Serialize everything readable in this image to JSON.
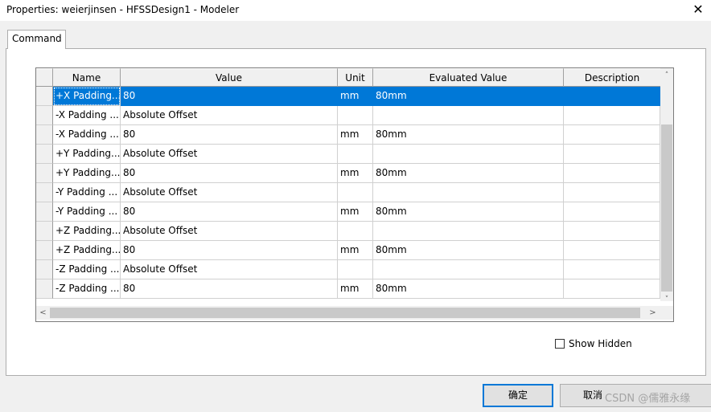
{
  "window": {
    "title": "Properties: weierjinsen - HFSSDesign1 - Modeler",
    "close_glyph": "✕"
  },
  "tab": {
    "label": "Command"
  },
  "table": {
    "columns": [
      "Name",
      "Value",
      "Unit",
      "Evaluated Value",
      "Description"
    ],
    "rows": [
      {
        "name": "+X Padding...",
        "value": "80",
        "unit": "mm",
        "evaluated": "80mm",
        "description": ""
      },
      {
        "name": "-X Padding ...",
        "value": "Absolute Offset",
        "unit": "",
        "evaluated": "",
        "description": ""
      },
      {
        "name": "-X Padding ...",
        "value": "80",
        "unit": "mm",
        "evaluated": "80mm",
        "description": ""
      },
      {
        "name": "+Y Padding...",
        "value": "Absolute Offset",
        "unit": "",
        "evaluated": "",
        "description": ""
      },
      {
        "name": "+Y Padding...",
        "value": "80",
        "unit": "mm",
        "evaluated": "80mm",
        "description": ""
      },
      {
        "name": "-Y Padding ...",
        "value": "Absolute Offset",
        "unit": "",
        "evaluated": "",
        "description": ""
      },
      {
        "name": "-Y Padding ...",
        "value": "80",
        "unit": "mm",
        "evaluated": "80mm",
        "description": ""
      },
      {
        "name": "+Z Padding...",
        "value": "Absolute Offset",
        "unit": "",
        "evaluated": "",
        "description": ""
      },
      {
        "name": "+Z Padding...",
        "value": "80",
        "unit": "mm",
        "evaluated": "80mm",
        "description": ""
      },
      {
        "name": "-Z Padding ...",
        "value": "Absolute Offset",
        "unit": "",
        "evaluated": "",
        "description": ""
      },
      {
        "name": "-Z Padding ...",
        "value": "80",
        "unit": "mm",
        "evaluated": "80mm",
        "description": ""
      }
    ],
    "selected_row": 0
  },
  "scroll": {
    "up": "˄",
    "down": "˅",
    "left": "<",
    "right": ">"
  },
  "show_hidden": {
    "label": "Show Hidden",
    "checked": false
  },
  "buttons": {
    "ok": "确定",
    "cancel": "取消"
  },
  "watermark": "CSDN @儒雅永缘",
  "colors": {
    "selection": "#0078d7",
    "background": "#f0f0f0"
  }
}
